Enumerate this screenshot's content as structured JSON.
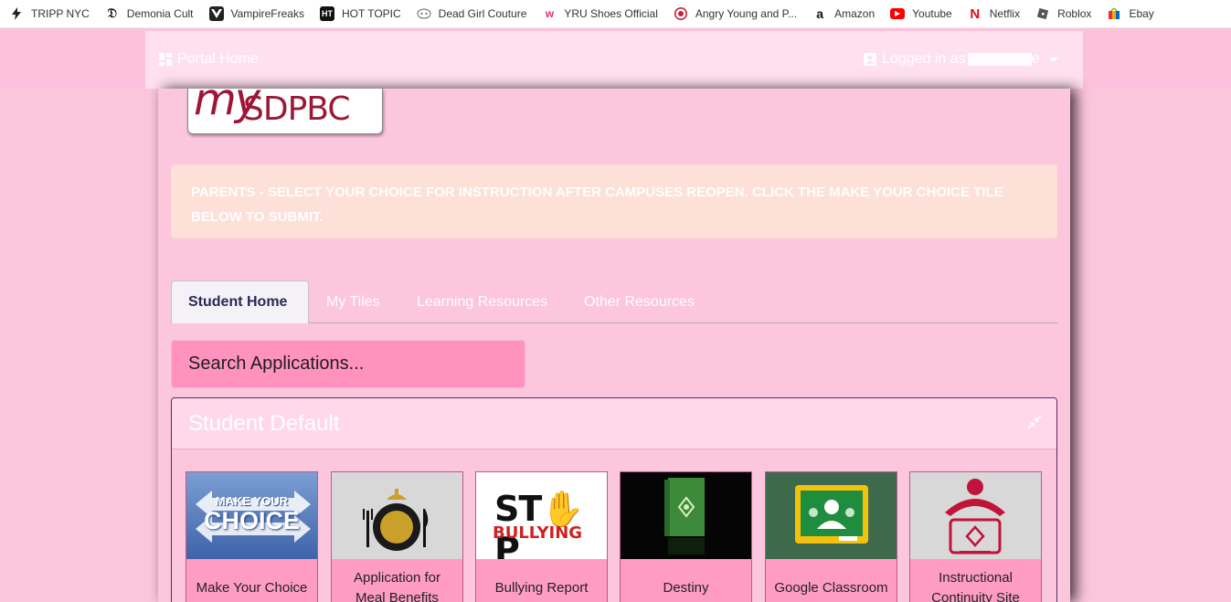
{
  "bookmarks": [
    {
      "label": "TRIPP NYC",
      "icon": "lightning-icon"
    },
    {
      "label": "Demonia Cult",
      "icon": "gothic-d-icon"
    },
    {
      "label": "VampireFreaks",
      "icon": "vampirefreaks-icon"
    },
    {
      "label": "HOT TOPIC",
      "icon": "hot-topic-icon"
    },
    {
      "label": "Dead Girl Couture",
      "icon": "dead-girl-icon"
    },
    {
      "label": "YRU Shoes Official",
      "icon": "yru-icon"
    },
    {
      "label": "Angry Young and P...",
      "icon": "angry-young-icon"
    },
    {
      "label": "Amazon",
      "icon": "amazon-icon"
    },
    {
      "label": "Youtube",
      "icon": "youtube-icon"
    },
    {
      "label": "Netflix",
      "icon": "netflix-icon"
    },
    {
      "label": "Roblox",
      "icon": "roblox-icon"
    },
    {
      "label": "Ebay",
      "icon": "ebay-icon"
    }
  ],
  "navbar": {
    "home_label": "Portal Home",
    "user_label": "Logged in as",
    "user_suffix": "e"
  },
  "logo": {
    "my": "my",
    "sd": "SDPBC"
  },
  "alert": {
    "text": "PARENTS - SELECT YOUR CHOICE FOR INSTRUCTION AFTER CAMPUSES REOPEN. CLICK THE MAKE YOUR CHOICE TILE BELOW TO SUBMIT."
  },
  "tabs": [
    {
      "label": "Student Home",
      "active": true
    },
    {
      "label": "My Tiles"
    },
    {
      "label": "Learning Resources"
    },
    {
      "label": "Other Resources"
    }
  ],
  "search": {
    "placeholder": "Search Applications..."
  },
  "section": {
    "title": "Student Default"
  },
  "tiles": [
    {
      "label": "Make Your Choice",
      "img_text_1": "MAKE YOUR",
      "img_text_2": "CHOICE"
    },
    {
      "label": "Application for Meal Benefits"
    },
    {
      "label": "Bullying Report",
      "img_text_1": "ST",
      "img_text_2": "P",
      "img_text_3": "BULLYING"
    },
    {
      "label": "Destiny"
    },
    {
      "label": "Google Classroom"
    },
    {
      "label": "Instructional Continuity Site"
    }
  ],
  "colors": {
    "page_bg": "#fcc6dd",
    "search_bg": "#ff92be",
    "tile_label_bg": "#ff9cc4",
    "alert_bg": "#fde0d8",
    "active_tab_text": "#2a2a55"
  }
}
